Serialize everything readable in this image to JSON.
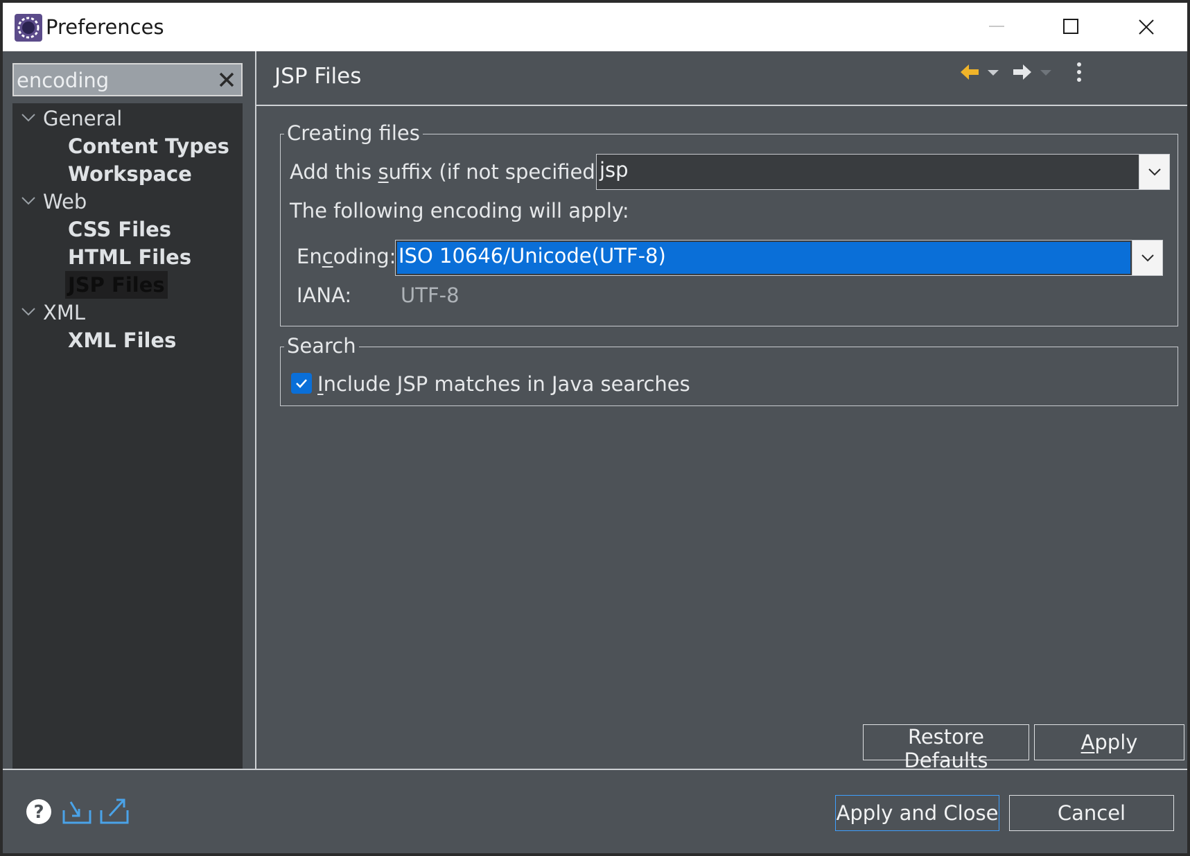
{
  "window": {
    "title": "Preferences",
    "controls": {
      "minimize": "minimize-icon",
      "maximize": "maximize-icon",
      "close": "close-icon"
    }
  },
  "filter": {
    "value": "encoding",
    "clear_icon": "clear-icon"
  },
  "tree": {
    "groups": [
      {
        "label": "General",
        "children": [
          "Content Types",
          "Workspace"
        ]
      },
      {
        "label": "Web",
        "children": [
          "CSS Files",
          "HTML Files",
          "JSP Files"
        ]
      },
      {
        "label": "XML",
        "children": [
          "XML Files"
        ]
      }
    ],
    "selected": "JSP Files"
  },
  "page": {
    "title": "JSP Files",
    "nav_icons": [
      "back-arrow-icon",
      "back-menu-icon",
      "forward-arrow-icon",
      "forward-menu-icon",
      "view-menu-icon"
    ],
    "creating_files": {
      "legend": "Creating files",
      "suffix_label_pre": "Add this ",
      "suffix_label_mn": "s",
      "suffix_label_post": "uffix (if not specified):",
      "suffix_value": "jsp",
      "encoding_note": "The following encoding will apply:",
      "encoding_label_pre": "En",
      "encoding_label_mn": "c",
      "encoding_label_post": "oding:",
      "encoding_value": "ISO 10646/Unicode(UTF-8)",
      "iana_label": "IANA:",
      "iana_value": "UTF-8"
    },
    "search": {
      "legend": "Search",
      "checkbox_checked": true,
      "checkbox_label_mn": "I",
      "checkbox_label_post": "nclude JSP matches in Java searches"
    },
    "buttons": {
      "restore_pre": "Restore ",
      "restore_mn": "D",
      "restore_post": "efaults",
      "apply_mn": "A",
      "apply_post": "pply"
    }
  },
  "footer": {
    "icons": [
      "help-icon",
      "import-icon",
      "export-icon"
    ],
    "apply_close": "Apply and Close",
    "cancel": "Cancel"
  },
  "colors": {
    "background": "#4d5257",
    "tree_background": "#2f3133",
    "selection": "#0a6fd8",
    "default_button_border": "#3ea0ff",
    "back_arrow": "#f0b429"
  }
}
